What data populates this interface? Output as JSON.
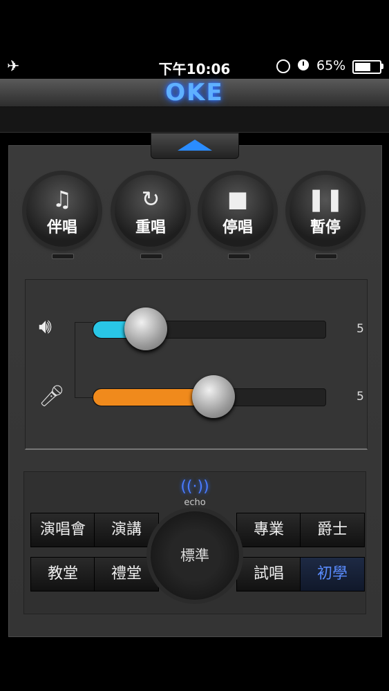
{
  "status": {
    "time": "下午10:06",
    "battery_text": "65%",
    "battery_level": 0.65
  },
  "header": {
    "logo": "OKE"
  },
  "controls": [
    {
      "label": "伴唱",
      "icon": "music-note-icon",
      "glyph": "♫"
    },
    {
      "label": "重唱",
      "icon": "replay-icon",
      "glyph": "↻"
    },
    {
      "label": "停唱",
      "icon": "stop-icon",
      "glyph": "■"
    },
    {
      "label": "暫停",
      "icon": "pause-icon",
      "glyph": "❚❚"
    }
  ],
  "sliders": {
    "volume": {
      "value": "5",
      "level": 0.23,
      "color": "#29c6e6",
      "icon": "speaker-icon"
    },
    "mic": {
      "value": "5",
      "level": 0.52,
      "color": "#f08a1c",
      "icon": "microphone-icon"
    }
  },
  "echo": {
    "label": "echo",
    "center": "標準",
    "modes_top": [
      "演唱會",
      "演講",
      "專業",
      "爵士"
    ],
    "modes_bottom": [
      "教堂",
      "禮堂",
      "試唱",
      "初學"
    ],
    "active": "初學",
    "accent": "#5a8cff"
  }
}
